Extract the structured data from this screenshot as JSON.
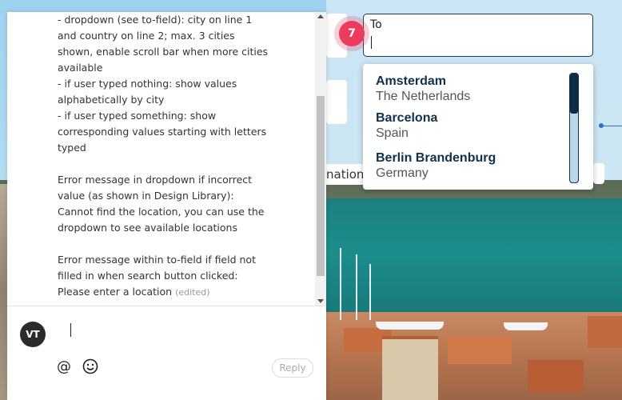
{
  "colors": {
    "accent_pin": "#ec3b5c",
    "navy": "#12304a",
    "link_blue": "#2f6fd6"
  },
  "background": {
    "partial_text": "nation"
  },
  "to_field": {
    "label": "To",
    "value": ""
  },
  "pin": {
    "number": "7"
  },
  "dropdown": {
    "items": [
      {
        "city": "Amsterdam",
        "country": "The Netherlands"
      },
      {
        "city": "Barcelona",
        "country": "Spain"
      },
      {
        "city": "Berlin Brandenburg",
        "country": "Germany"
      }
    ]
  },
  "comment": {
    "lines": [
      "- dropdown (see to-field): city on line 1",
      "and country on line 2; max. 3 cities",
      "shown, enable scroll bar when more cities",
      "available",
      "- if user typed nothing: show values",
      "alphabetically by city",
      "- if user typed something: show",
      "corresponding values starting with letters",
      "typed",
      "",
      "Error message in dropdown if incorrect",
      "value (as shown in Design Library):",
      "Cannot find the location, you can use the",
      "dropdown to see available locations",
      "",
      "Error message within to-field if field not",
      "filled in when search button clicked:",
      "Please enter a location"
    ],
    "edited_tag": "(edited)"
  },
  "reply": {
    "avatar_initials": "VT",
    "input_value": "",
    "mention_icon": "@",
    "emoji_icon": "smiley-icon",
    "button_label": "Reply"
  }
}
